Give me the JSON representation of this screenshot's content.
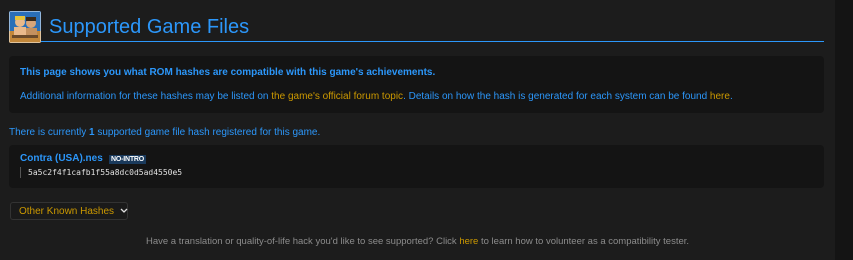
{
  "header": {
    "title": "Supported Game Files",
    "icon": "game-box-art-icon"
  },
  "info": {
    "bold_text": "This page shows you what ROM hashes are compatible with this game's achievements.",
    "line_prefix": "Additional information for these hashes may be listed on ",
    "forum_link": "the game's official forum topic",
    "line_middle": ". Details on how the hash is generated for each system can be found ",
    "here_link": "here",
    "line_suffix": "."
  },
  "count_line": {
    "prefix": "There is currently ",
    "count": "1",
    "suffix": " supported game file hash registered for this game."
  },
  "hashes": [
    {
      "name": "Contra (USA).nes",
      "badge": "NO-INTRO",
      "hash": "5a5c2f4f1cafb1f55a8dc0d5ad4550e5"
    }
  ],
  "other_hashes_button": {
    "label": "Other Known Hashes",
    "icon": "chevron-down-icon"
  },
  "footer": {
    "prefix": "Have a translation or quality-of-life hack you'd like to see supported? Click ",
    "link": "here",
    "suffix": " to learn how to volunteer as a compatibility tester."
  },
  "colors": {
    "accent": "#2c97fa",
    "link": "#cc9900",
    "background": "#1c1c1c",
    "panel": "#141414",
    "muted": "#8c8c8c"
  }
}
